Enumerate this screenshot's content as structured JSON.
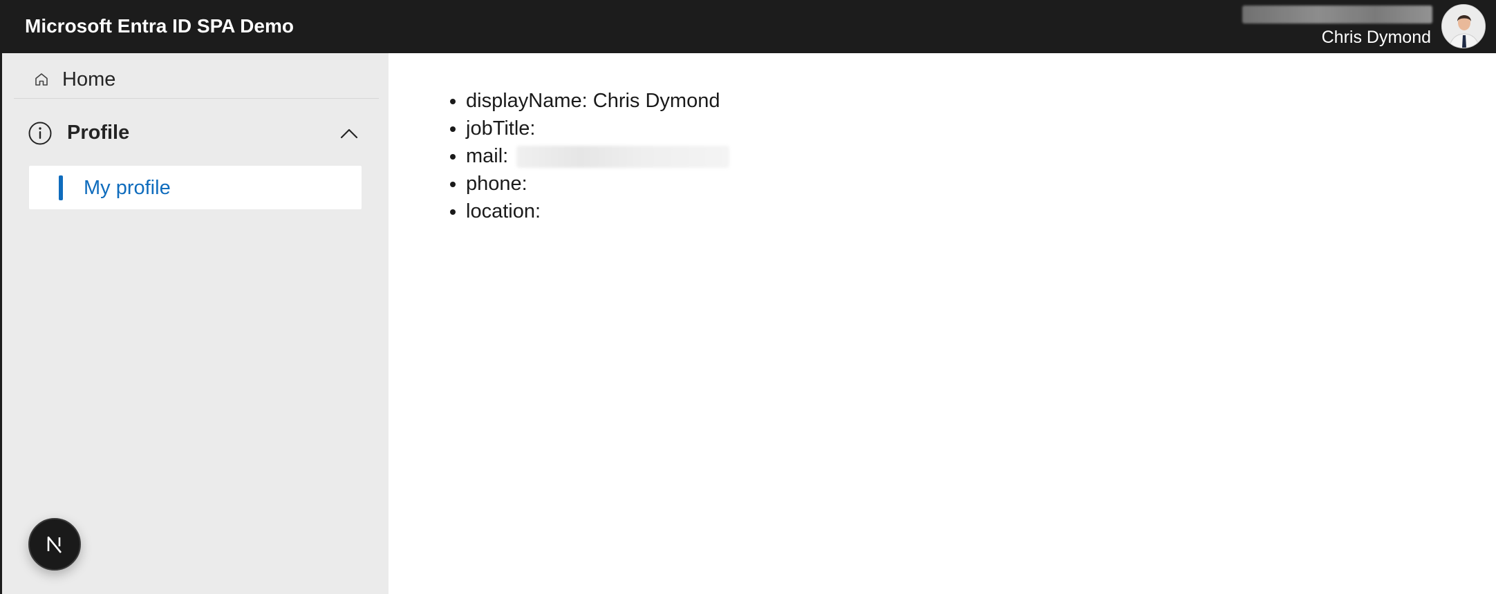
{
  "header": {
    "title": "Microsoft Entra ID SPA Demo",
    "user_name": "Chris Dymond"
  },
  "sidebar": {
    "home_label": "Home",
    "profile_label": "Profile",
    "profile_expanded": true,
    "items": [
      {
        "label": "My profile",
        "active": true
      }
    ]
  },
  "main": {
    "fields": [
      {
        "key": "displayName",
        "label": "displayName:",
        "value": "Chris Dymond"
      },
      {
        "key": "jobTitle",
        "label": "jobTitle:",
        "value": ""
      },
      {
        "key": "mail",
        "label": "mail:",
        "value": ""
      },
      {
        "key": "phone",
        "label": "phone:",
        "value": ""
      },
      {
        "key": "location",
        "label": "location:",
        "value": ""
      }
    ]
  },
  "badge": {
    "letter": "N",
    "icon": "nextjs-logo-icon"
  },
  "colors": {
    "header_bg": "#1c1c1c",
    "sidebar_bg": "#ebebeb",
    "accent": "#0f6cbd"
  }
}
